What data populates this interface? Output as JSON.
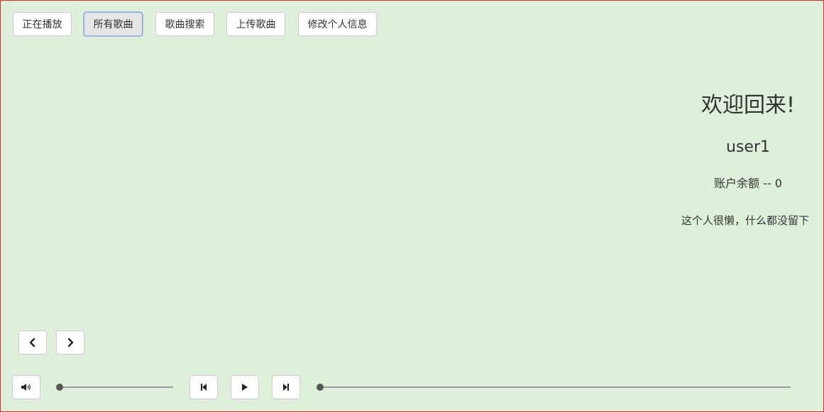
{
  "nav": {
    "items": [
      {
        "label": "正在播放",
        "active": false
      },
      {
        "label": "所有歌曲",
        "active": true
      },
      {
        "label": "歌曲搜索",
        "active": false
      },
      {
        "label": "上传歌曲",
        "active": false
      },
      {
        "label": "修改个人信息",
        "active": false
      }
    ]
  },
  "profile": {
    "welcome": "欢迎回来!",
    "username": "user1",
    "balance": "账户余额 -- 0",
    "bio": "这个人很懒，什么都没留下"
  },
  "pager": {
    "prev_icon": "chevron-left-icon",
    "next_icon": "chevron-right-icon"
  },
  "player": {
    "volume_icon": "volume-icon",
    "prev_icon": "skip-previous-icon",
    "play_icon": "play-icon",
    "next_icon": "skip-next-icon",
    "volume_level": 0,
    "progress": 0
  },
  "colors": {
    "background": "#dff0da",
    "border": "#d9302c",
    "text": "#333333"
  }
}
